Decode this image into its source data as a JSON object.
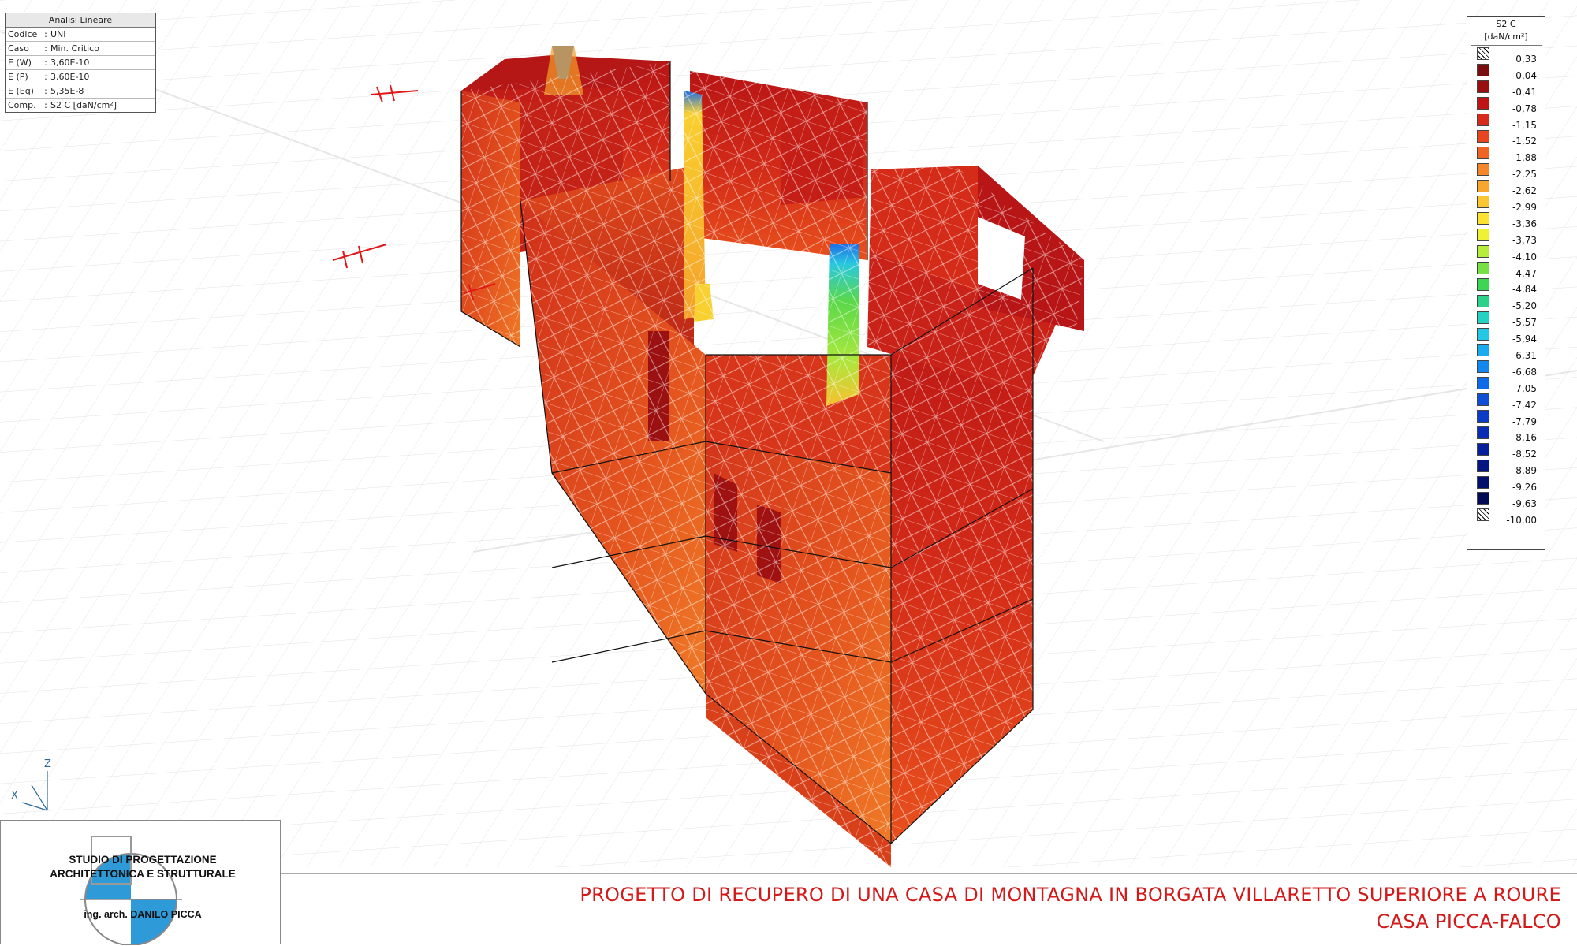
{
  "info_panel": {
    "title": "Analisi Lineare",
    "rows": [
      {
        "key": "Codice",
        "value": "UNI"
      },
      {
        "key": "Caso",
        "value": "Min. Critico"
      },
      {
        "key": "E (W)",
        "value": "3,60E-10"
      },
      {
        "key": "E (P)",
        "value": "3,60E-10"
      },
      {
        "key": "E (Eq)",
        "value": "5,35E-8"
      },
      {
        "key": "Comp.",
        "value": "S2 C [daN/cm²]"
      }
    ]
  },
  "legend": {
    "title": "S2 C",
    "unit": "[daN/cm²]",
    "entries": [
      {
        "value": "0,33",
        "color": "hatch"
      },
      {
        "value": "-0,04",
        "color": "#7a0d0d"
      },
      {
        "value": "-0,41",
        "color": "#9a1010"
      },
      {
        "value": "-0,78",
        "color": "#c01414"
      },
      {
        "value": "-1,15",
        "color": "#d82a1a"
      },
      {
        "value": "-1,52",
        "color": "#e8441e"
      },
      {
        "value": "-1,88",
        "color": "#f06424"
      },
      {
        "value": "-2,25",
        "color": "#f5862a"
      },
      {
        "value": "-2,62",
        "color": "#f9a62e"
      },
      {
        "value": "-2,99",
        "color": "#fcc632"
      },
      {
        "value": "-3,36",
        "color": "#fde232"
      },
      {
        "value": "-3,73",
        "color": "#eef232"
      },
      {
        "value": "-4,10",
        "color": "#b6ec3a"
      },
      {
        "value": "-4,47",
        "color": "#76e044"
      },
      {
        "value": "-4,84",
        "color": "#3cd654"
      },
      {
        "value": "-5,20",
        "color": "#2cd28a"
      },
      {
        "value": "-5,57",
        "color": "#26d2c2"
      },
      {
        "value": "-5,94",
        "color": "#22c8e6"
      },
      {
        "value": "-6,31",
        "color": "#1aaaf0"
      },
      {
        "value": "-6,68",
        "color": "#1088f0"
      },
      {
        "value": "-7,05",
        "color": "#0e6ae8"
      },
      {
        "value": "-7,42",
        "color": "#0c50d8"
      },
      {
        "value": "-7,79",
        "color": "#0a3cc8"
      },
      {
        "value": "-8,16",
        "color": "#082cb4"
      },
      {
        "value": "-8,52",
        "color": "#06209c"
      },
      {
        "value": "-8,89",
        "color": "#041684"
      },
      {
        "value": "-9,26",
        "color": "#030f6c"
      },
      {
        "value": "-9,63",
        "color": "#020a54"
      },
      {
        "value": "-10,00",
        "color": "hatch"
      }
    ]
  },
  "axis": {
    "z": "Z",
    "x": "X"
  },
  "logo": {
    "line1": "STUDIO DI PROGETTAZIONE",
    "line2": "ARCHITETTONICA E STRUTTURALE",
    "line3": "ing. arch. DANILO PICCA"
  },
  "footer": {
    "line1": "PROGETTO DI RECUPERO DI UNA CASA DI MONTAGNA IN BORGATA VILLARETTO SUPERIORE A ROURE",
    "line2": "CASA PICCA-FALCO"
  }
}
